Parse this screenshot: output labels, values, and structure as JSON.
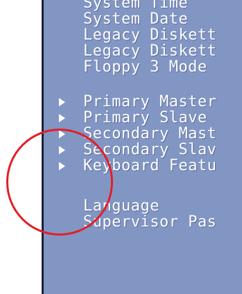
{
  "bios_menu": {
    "items": [
      {
        "label": "System Time",
        "has_submenu": false
      },
      {
        "label": "System Date",
        "has_submenu": false
      },
      {
        "label": "Legacy Diskett",
        "has_submenu": false
      },
      {
        "label": "Legacy Diskett",
        "has_submenu": false
      },
      {
        "label": "Floppy 3 Mode",
        "has_submenu": false
      },
      {
        "label": "Primary Master",
        "has_submenu": true
      },
      {
        "label": "Primary Slave",
        "has_submenu": true
      },
      {
        "label": "Secondary Mast",
        "has_submenu": true
      },
      {
        "label": "Secondary Slav",
        "has_submenu": true
      },
      {
        "label": "Keyboard Featu",
        "has_submenu": true
      },
      {
        "label": "Language",
        "has_submenu": false
      },
      {
        "label": "Supervisor Pas",
        "has_submenu": false
      }
    ]
  },
  "colors": {
    "panel_background": "#8296c4",
    "text": "#ffffff",
    "annotation_circle": "#e21f26"
  },
  "icons": {
    "submenu_indicator": "triangle-right-icon"
  }
}
